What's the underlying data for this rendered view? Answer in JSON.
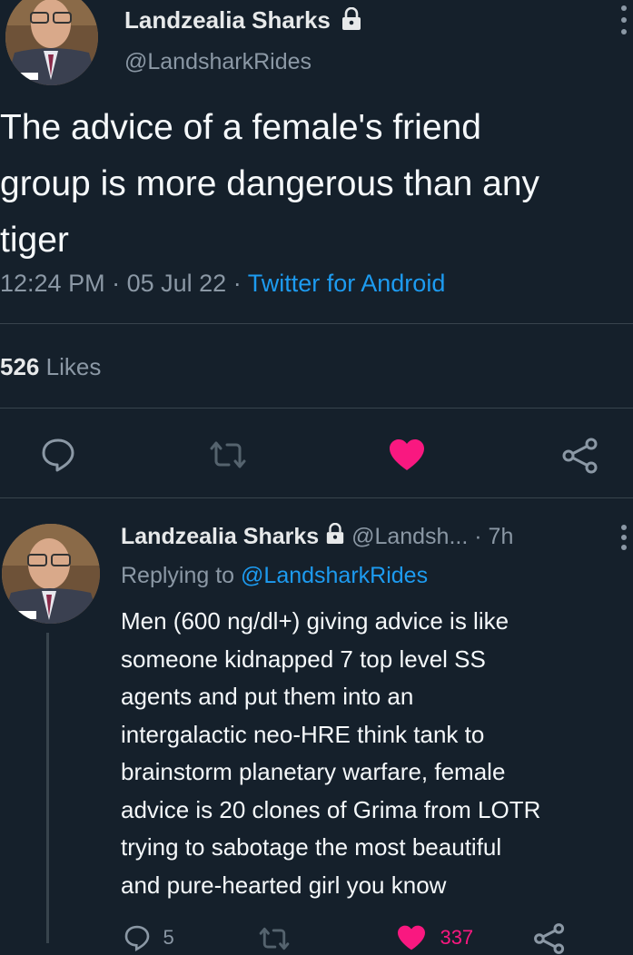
{
  "main_tweet": {
    "author_name": "Landzealia Sharks",
    "author_handle": "@LandsharkRides",
    "text_line1": "The advice of a female's friend",
    "text_line2": "group is more dangerous than any",
    "text_line3": "tiger",
    "time": "12:24 PM",
    "date": "05 Jul 22",
    "sep1": "·",
    "sep2": "·",
    "source": "Twitter for Android",
    "likes_count": "526",
    "likes_label": "Likes"
  },
  "reply_tweet": {
    "author_name": "Landzealia Sharks",
    "author_handle": "@Landsh...",
    "time_sep": "·",
    "time_ago": "7h",
    "replying_prefix": "Replying to",
    "replying_handle": "@LandsharkRides",
    "lines": [
      "Men (600 ng/dl+) giving advice is like",
      "someone kidnapped 7 top level SS",
      "agents and put them into an",
      "intergalactic neo-HRE think tank to",
      "brainstorm planetary warfare, female",
      "advice is 20 clones of Grima from LOTR",
      "trying to sabotage the most beautiful",
      "and pure-hearted girl you know"
    ],
    "reply_count": "5",
    "like_count": "337"
  },
  "colors": {
    "background": "#15202b",
    "link": "#1d9bf0",
    "like": "#f91880",
    "muted": "#8b98a5",
    "divider": "#38444d"
  },
  "icons": {
    "lock": "lock-icon",
    "more": "more-vertical-icon",
    "reply": "reply-icon",
    "retweet": "retweet-icon",
    "like": "heart-icon",
    "share": "share-icon"
  }
}
